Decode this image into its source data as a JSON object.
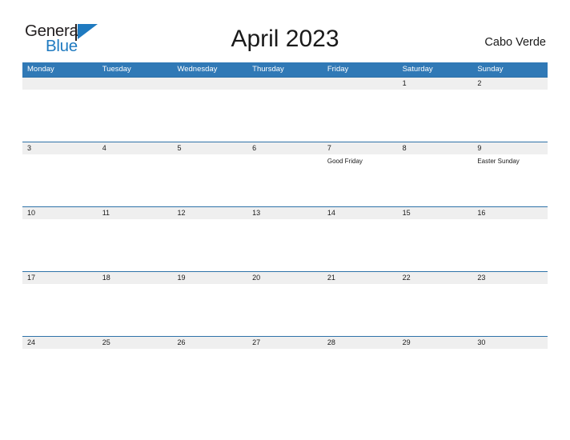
{
  "brand": {
    "word_one": "General",
    "word_two": "Blue",
    "flag_icon": "blue-flag-triangle-icon",
    "accent_color": "#1f7ac0"
  },
  "header": {
    "title": "April 2023",
    "locale": "Cabo Verde"
  },
  "colors": {
    "header_blue": "#3079b6",
    "band_gray": "#efefef",
    "band_rule": "#2e72a8",
    "text": "#1a1a1a"
  },
  "calendar": {
    "weekday_headers": [
      "Monday",
      "Tuesday",
      "Wednesday",
      "Thursday",
      "Friday",
      "Saturday",
      "Sunday"
    ],
    "weeks": [
      {
        "days": [
          {
            "num": "",
            "event": ""
          },
          {
            "num": "",
            "event": ""
          },
          {
            "num": "",
            "event": ""
          },
          {
            "num": "",
            "event": ""
          },
          {
            "num": "",
            "event": ""
          },
          {
            "num": "1",
            "event": ""
          },
          {
            "num": "2",
            "event": ""
          }
        ]
      },
      {
        "days": [
          {
            "num": "3",
            "event": ""
          },
          {
            "num": "4",
            "event": ""
          },
          {
            "num": "5",
            "event": ""
          },
          {
            "num": "6",
            "event": ""
          },
          {
            "num": "7",
            "event": "Good Friday"
          },
          {
            "num": "8",
            "event": ""
          },
          {
            "num": "9",
            "event": "Easter Sunday"
          }
        ]
      },
      {
        "days": [
          {
            "num": "10",
            "event": ""
          },
          {
            "num": "11",
            "event": ""
          },
          {
            "num": "12",
            "event": ""
          },
          {
            "num": "13",
            "event": ""
          },
          {
            "num": "14",
            "event": ""
          },
          {
            "num": "15",
            "event": ""
          },
          {
            "num": "16",
            "event": ""
          }
        ]
      },
      {
        "days": [
          {
            "num": "17",
            "event": ""
          },
          {
            "num": "18",
            "event": ""
          },
          {
            "num": "19",
            "event": ""
          },
          {
            "num": "20",
            "event": ""
          },
          {
            "num": "21",
            "event": ""
          },
          {
            "num": "22",
            "event": ""
          },
          {
            "num": "23",
            "event": ""
          }
        ]
      },
      {
        "days": [
          {
            "num": "24",
            "event": ""
          },
          {
            "num": "25",
            "event": ""
          },
          {
            "num": "26",
            "event": ""
          },
          {
            "num": "27",
            "event": ""
          },
          {
            "num": "28",
            "event": ""
          },
          {
            "num": "29",
            "event": ""
          },
          {
            "num": "30",
            "event": ""
          }
        ]
      }
    ]
  }
}
